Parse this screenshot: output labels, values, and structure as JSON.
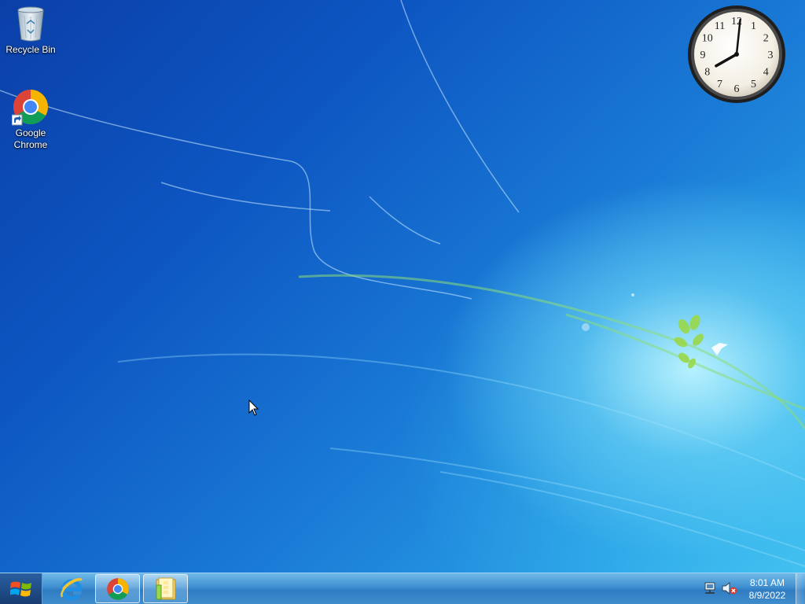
{
  "desktop": {
    "icons": [
      {
        "label": "Recycle Bin",
        "icon": "recycle-bin-icon"
      },
      {
        "label": "Google\nChrome",
        "icon": "chrome-icon"
      }
    ]
  },
  "clock_gadget": {
    "numerals": [
      "12",
      "1",
      "2",
      "3",
      "4",
      "5",
      "6",
      "7",
      "8",
      "9",
      "10",
      "11"
    ],
    "time": "8:01"
  },
  "taskbar": {
    "start_icon": "windows-logo-icon",
    "pinned": [
      {
        "name": "Internet Explorer",
        "icon": "internet-explorer-icon",
        "active": false
      },
      {
        "name": "Google Chrome",
        "icon": "chrome-icon",
        "active": true
      },
      {
        "name": "Windows Explorer",
        "icon": "file-explorer-icon",
        "active": true
      }
    ],
    "tray": {
      "network_icon": "network-icon",
      "volume_icon": "volume-muted-icon",
      "time": "8:01 AM",
      "date": "8/9/2022"
    }
  },
  "colors": {
    "desktop_blue": "#0d56c2",
    "taskbar": "#3f8fd0",
    "accent_green": "#9ad84a"
  }
}
